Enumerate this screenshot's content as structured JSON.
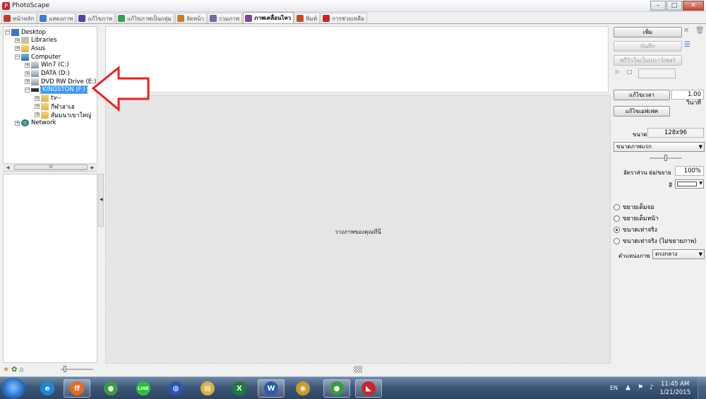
{
  "window": {
    "title": "PhotoScape",
    "app_icon_glyph": "P",
    "minimize_glyph": "–",
    "maximize_glyph": "□",
    "close_glyph": "✕"
  },
  "tabs": [
    {
      "label": "หน้าหลัก",
      "color": "#c73a2a",
      "active": false
    },
    {
      "label": "แสดงภาพ",
      "color": "#3a7ecb",
      "active": false
    },
    {
      "label": "แก้ไขภาพ",
      "color": "#5a3fa5",
      "active": false
    },
    {
      "label": "แก้ไขภาพเป็นกลุ่ม",
      "color": "#3f9d5a",
      "active": false
    },
    {
      "label": "จัดหน้า",
      "color": "#c2832a",
      "active": false
    },
    {
      "label": "รวมภาพ",
      "color": "#6d6d9c",
      "active": false
    },
    {
      "label": "ภาพเคลื่อนไหว",
      "color": "#8a3f9c",
      "active": true
    },
    {
      "label": "พิมพ์",
      "color": "#c74b2a",
      "active": false
    },
    {
      "label": "การช่วยเหลือ",
      "color": "#d02222",
      "active": false
    }
  ],
  "tree": {
    "items": [
      {
        "label": "Desktop",
        "icon": "desktop-icon",
        "expander": "−"
      },
      {
        "label": "Libraries",
        "icon": "libraries-icon",
        "expander": "+"
      },
      {
        "label": "Asus",
        "icon": "folder-icon",
        "expander": "+"
      },
      {
        "label": "Computer",
        "icon": "computer-icon",
        "expander": "−"
      },
      {
        "label": "Win7 (C:)",
        "icon": "drive-icon",
        "expander": "+"
      },
      {
        "label": "DATA (D:)",
        "icon": "drive-icon",
        "expander": "+"
      },
      {
        "label": "DVD RW Drive (E:)",
        "icon": "dvd-drive-icon",
        "expander": "+"
      },
      {
        "label": "KINGSTON (F:)",
        "icon": "usb-drive-icon",
        "expander": "−",
        "selected": true
      },
      {
        "label": "tv--",
        "icon": "folder-icon",
        "expander": "+"
      },
      {
        "label": "กีฬาฮาเฮ",
        "icon": "folder-icon",
        "expander": "+"
      },
      {
        "label": "สัมมนาเขาใหญ่",
        "icon": "folder-icon",
        "expander": "+"
      },
      {
        "label": "Network",
        "icon": "network-icon",
        "expander": "+"
      }
    ],
    "hscroll_left": "◀",
    "hscroll_right": "▶",
    "hscroll_grip": "III"
  },
  "splitter_glyph": "◀",
  "canvas": {
    "hint": "วางภาพของคุณที่นี่"
  },
  "right_panel": {
    "add_label": "เพิ่ม",
    "save_label": "บันทึก",
    "preview_browser_label": "พรีวิวในเว็บเบราว์เซอร์",
    "play_glyph": "▷",
    "stop_glyph": "□",
    "edit_time_label": "แก้ไขเวลา",
    "time_value": "1.00 วินาที",
    "edit_effect_label": "แก้ไขเอฟเฟค",
    "size_label": "ขนาด",
    "size_value": "128x96",
    "size_mode_value": "ขนาดภาพแรก",
    "zoom_ratio_label": "อัตราส่วน ย่อ/ขยาย",
    "zoom_ratio_value": "100%",
    "color_label": "สี",
    "background_color": "#ffffff",
    "radio_options": [
      {
        "label": "ขยายเต็มจอ",
        "checked": false
      },
      {
        "label": "ขยายเต็มหน้า",
        "checked": false
      },
      {
        "label": "ขนาดเท่าจริง",
        "checked": true
      },
      {
        "label": "ขนาดเท่าจริง (ไม่ขยายภาพ)",
        "checked": false
      }
    ],
    "position_label": "ตำแหน่งภาพ",
    "position_value": "ตรงกลาง",
    "dropdown_glyph": "▼"
  },
  "taskbar": {
    "apps": [
      {
        "name": "internet-explorer",
        "glyph": "e",
        "color": "#1f86d6"
      },
      {
        "name": "firefox",
        "glyph": "ff",
        "color": "#e66a1f",
        "active": true
      },
      {
        "name": "chrome",
        "glyph": "●",
        "color": "#3a9b3f"
      },
      {
        "name": "line",
        "glyph": "LINE",
        "color": "#2fbd3a"
      },
      {
        "name": "google-earth",
        "glyph": "◍",
        "color": "#2a56b3"
      },
      {
        "name": "file-explorer",
        "glyph": "▤",
        "color": "#d9b04a"
      },
      {
        "name": "excel",
        "glyph": "X",
        "color": "#1e7b3c"
      },
      {
        "name": "word",
        "glyph": "W",
        "color": "#2a5bb0",
        "active": true
      },
      {
        "name": "media-player",
        "glyph": "◉",
        "color": "#c79a2a"
      },
      {
        "name": "chrome-2",
        "glyph": "●",
        "color": "#3a9b3f",
        "active": true
      },
      {
        "name": "photoscape",
        "glyph": "◣",
        "color": "#c8262b",
        "active": true
      }
    ],
    "language": "EN",
    "clock_time": "11:45 AM",
    "clock_date": "1/21/2015"
  }
}
